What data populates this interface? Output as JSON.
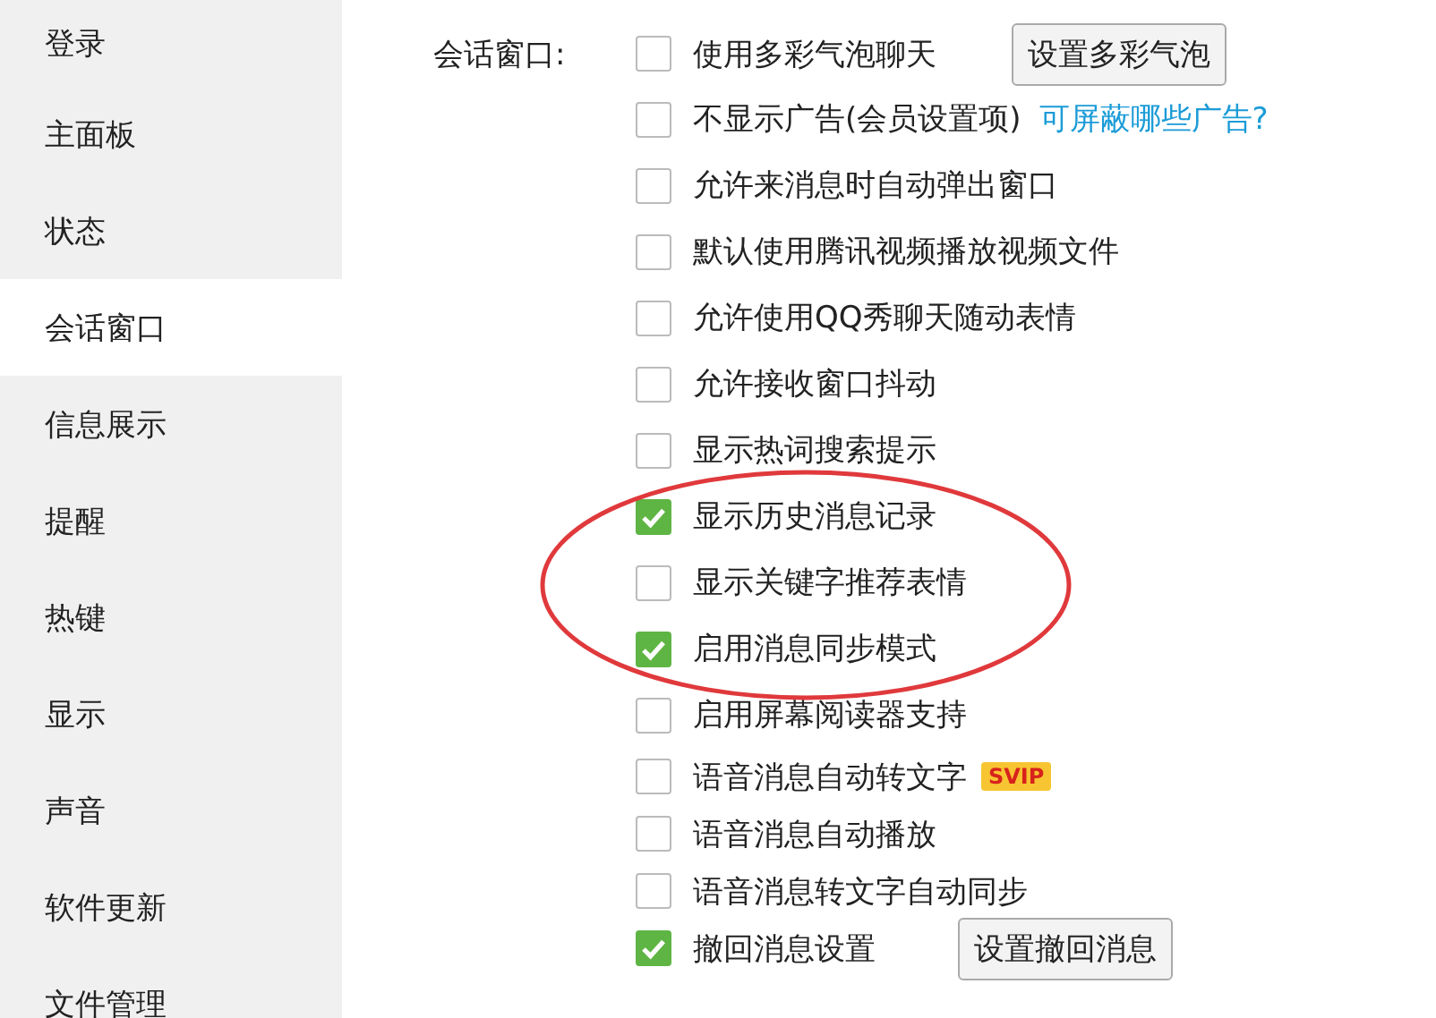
{
  "sidebar": {
    "items": [
      {
        "label": "登录",
        "selected": false
      },
      {
        "label": "主面板",
        "selected": false
      },
      {
        "label": "状态",
        "selected": false
      },
      {
        "label": "会话窗口",
        "selected": true
      },
      {
        "label": "信息展示",
        "selected": false
      },
      {
        "label": "提醒",
        "selected": false
      },
      {
        "label": "热键",
        "selected": false
      },
      {
        "label": "显示",
        "selected": false
      },
      {
        "label": "声音",
        "selected": false
      },
      {
        "label": "软件更新",
        "selected": false
      },
      {
        "label": "文件管理",
        "selected": false
      }
    ]
  },
  "section": {
    "label": "会话窗口:",
    "options": [
      {
        "label": "使用多彩气泡聊天",
        "checked": false,
        "button": "设置多彩气泡"
      },
      {
        "label": "不显示广告(会员设置项)",
        "checked": false,
        "link": "可屏蔽哪些广告?"
      },
      {
        "label": "允许来消息时自动弹出窗口",
        "checked": false
      },
      {
        "label": "默认使用腾讯视频播放视频文件",
        "checked": false
      },
      {
        "label": "允许使用QQ秀聊天随动表情",
        "checked": false
      },
      {
        "label": "允许接收窗口抖动",
        "checked": false
      },
      {
        "label": "显示热词搜索提示",
        "checked": false
      },
      {
        "label": "显示历史消息记录",
        "checked": true
      },
      {
        "label": "显示关键字推荐表情",
        "checked": false
      },
      {
        "label": "启用消息同步模式",
        "checked": true
      },
      {
        "label": "启用屏幕阅读器支持",
        "checked": false
      },
      {
        "label": "语音消息自动转文字",
        "checked": false,
        "badge": "SVIP"
      },
      {
        "label": "语音消息自动播放",
        "checked": false
      },
      {
        "label": "语音消息转文字自动同步",
        "checked": false
      },
      {
        "label": "撤回消息设置",
        "checked": true,
        "button": "设置撤回消息"
      }
    ]
  },
  "annotation": {
    "kind": "ellipse"
  }
}
